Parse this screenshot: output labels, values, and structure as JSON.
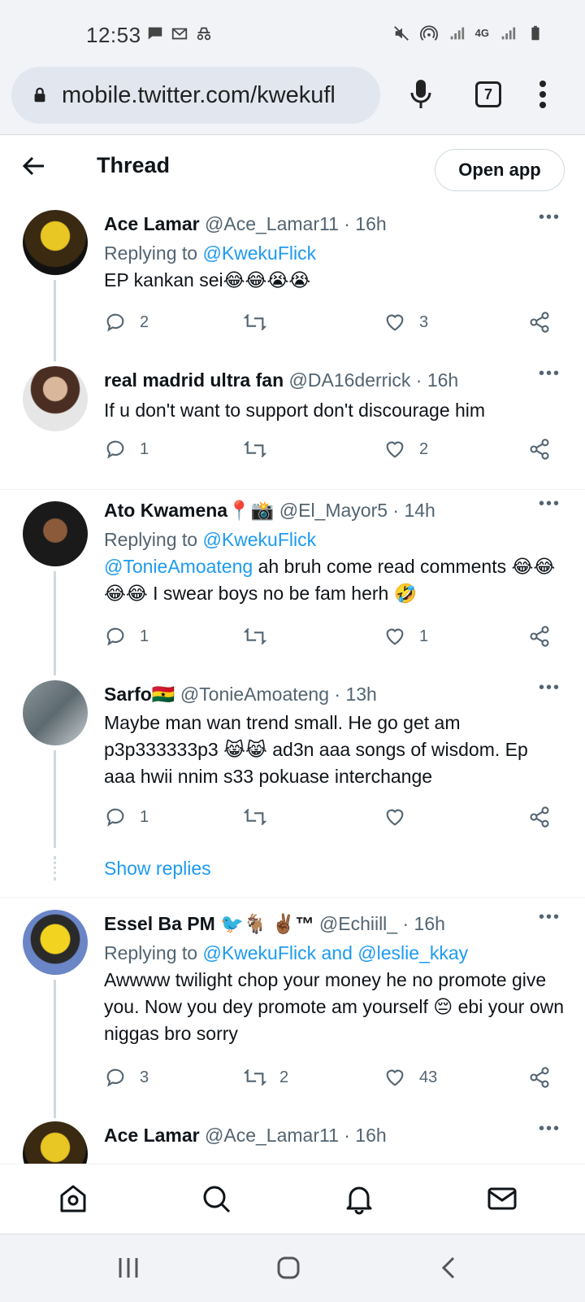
{
  "status_bar": {
    "time": "12:53",
    "left_icons": [
      "chat-bubble-icon",
      "gmail-icon",
      "incognito-icon"
    ],
    "right_icons": [
      "mute-icon",
      "hotspot-icon",
      "signal-icon",
      "4g-icon",
      "signal-icon",
      "battery-icon"
    ],
    "network_label": "4G"
  },
  "browser": {
    "url": "mobile.twitter.com/kwekufl",
    "tab_count": "7"
  },
  "header": {
    "title": "Thread",
    "open_app_label": "Open app"
  },
  "tweets": [
    {
      "name": "Ace Lamar",
      "handle": "@Ace_Lamar11 · 16h",
      "replying_prefix": "Replying to ",
      "replying_to": "@KwekuFlick",
      "text": "EP kankan sei😂😂😭😭",
      "replies": "2",
      "retweets": "",
      "likes": "3"
    },
    {
      "name": "real madrid ultra fan",
      "handle": "@DA16derrick · 16h",
      "text": "If u don't want to support don't discourage him",
      "replies": "1",
      "retweets": "",
      "likes": "2"
    },
    {
      "name": "Ato Kwamena📍📸",
      "handle": "@El_Mayor5 · 14h",
      "replying_prefix": "Replying to ",
      "replying_to": "@KwekuFlick",
      "mention": "@TonieAmoateng",
      "text": " ah bruh come read comments 😂😂😂😂 I swear boys no be fam herh 🤣",
      "replies": "1",
      "retweets": "",
      "likes": "1"
    },
    {
      "name": "Sarfo🇬🇭",
      "handle": "@TonieAmoateng · 13h",
      "text": "Maybe man wan trend small. He go get am p3p333333p3 😹😹 ad3n aaa songs of wisdom. Ep aaa hwii nnim s33 pokuase interchange",
      "replies": "1",
      "retweets": "",
      "likes": ""
    },
    {
      "name": "Essel Ba PM 🐦🐐 ✌🏾™",
      "handle": "@Echiill_ · 16h",
      "replying_prefix": "Replying to ",
      "replying_to": "@KwekuFlick and @leslie_kkay",
      "text": "Awwww twilight chop your money he no promote give you. Now you dey promote am yourself 😔 ebi your own niggas bro sorry",
      "replies": "3",
      "retweets": "2",
      "likes": "43"
    },
    {
      "name": "Ace Lamar",
      "handle": "@Ace_Lamar11 · 16h"
    }
  ],
  "show_replies_label": "Show replies",
  "bottom_nav": [
    "home-icon",
    "search-icon",
    "notifications-icon",
    "messages-icon"
  ],
  "system_nav": [
    "recents-icon",
    "home-button-icon",
    "back-icon"
  ],
  "colors": {
    "accent": "#1d9bf0",
    "text_primary": "#0f1419",
    "text_secondary": "#536471",
    "browser_chrome": "#f1f3f6"
  }
}
